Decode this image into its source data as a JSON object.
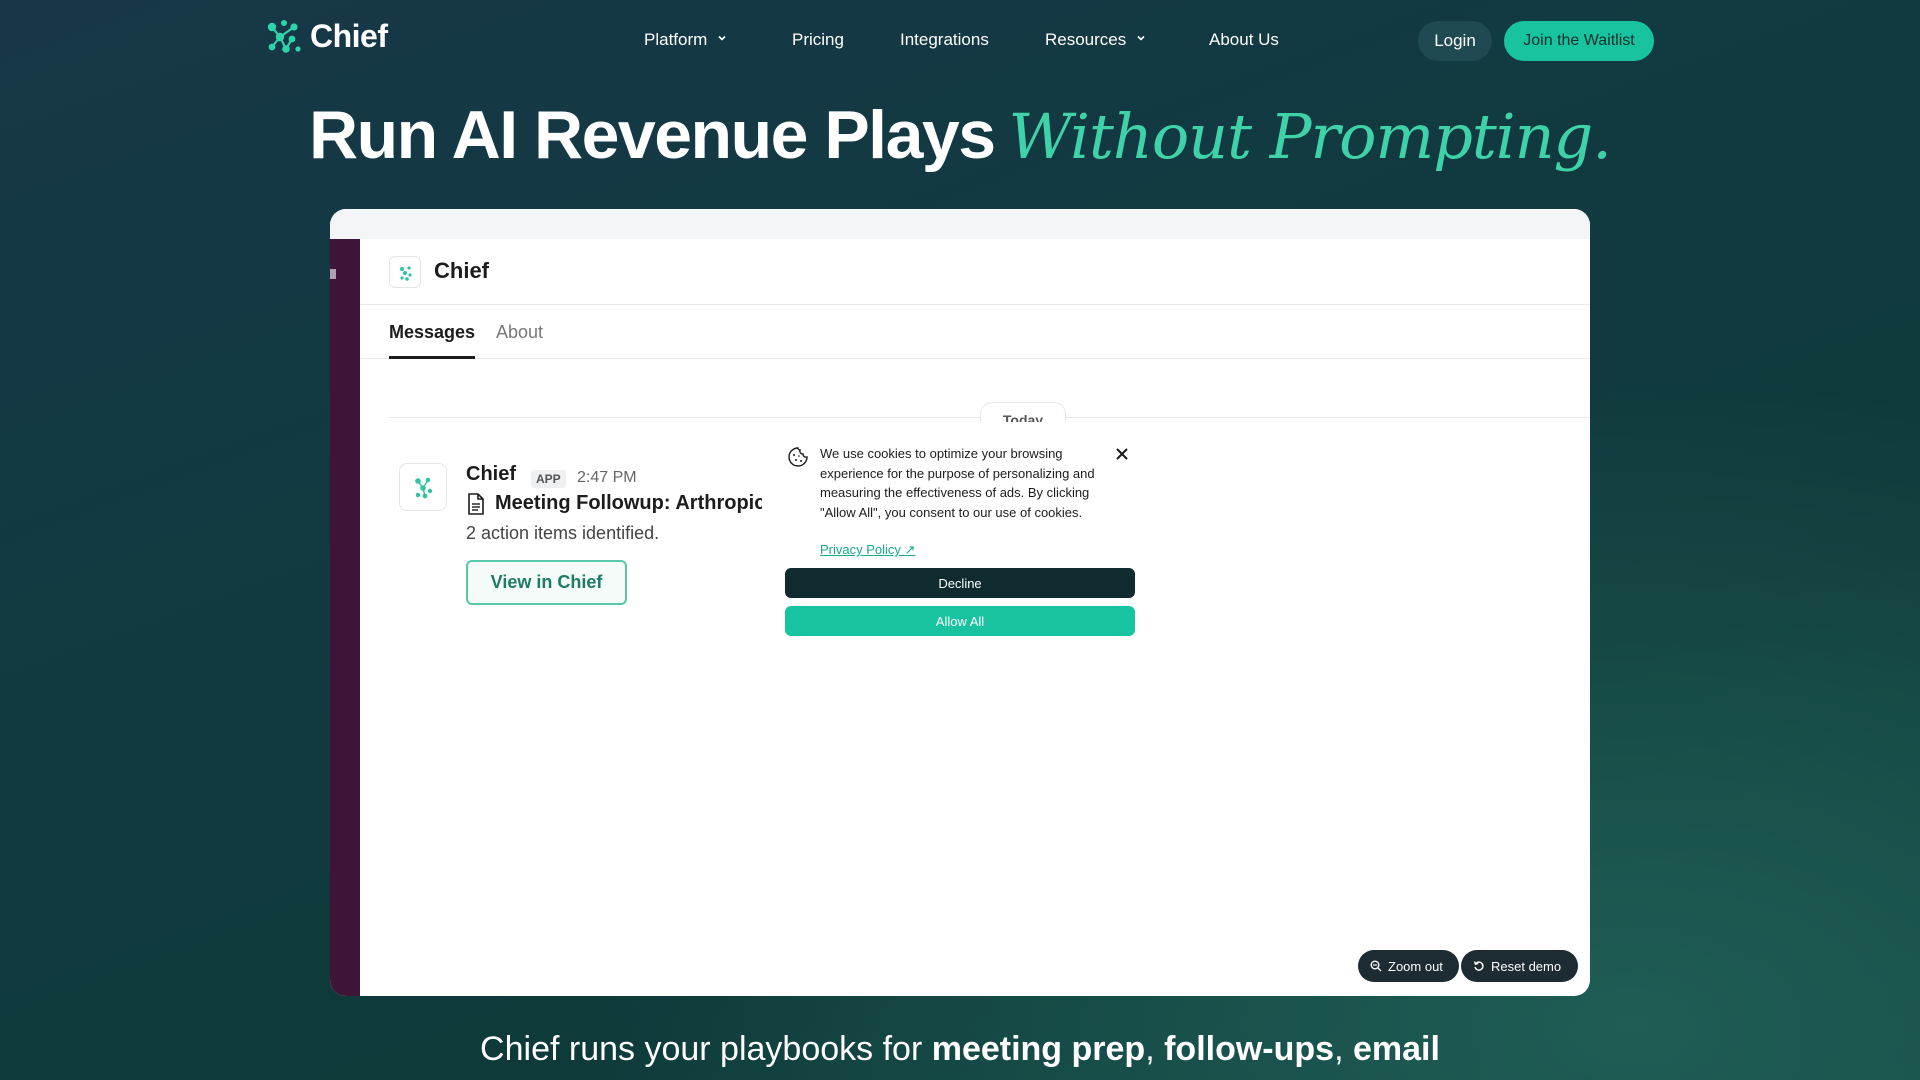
{
  "nav": {
    "logo_text": "Chief",
    "links": [
      {
        "label": "Platform",
        "has_chevron": true
      },
      {
        "label": "Pricing",
        "has_chevron": false
      },
      {
        "label": "Integrations",
        "has_chevron": false
      },
      {
        "label": "Resources",
        "has_chevron": true
      },
      {
        "label": "About Us",
        "has_chevron": false
      }
    ],
    "login_label": "Login",
    "waitlist_label": "Join the Waitlist"
  },
  "hero": {
    "main": "Run AI Revenue Plays",
    "accent": "Without Prompting."
  },
  "demo": {
    "channel_name": "Chief",
    "tabs": [
      "Messages",
      "About"
    ],
    "day_label": "Today",
    "message": {
      "sender": "Chief",
      "badge": "APP",
      "time": "2:47 PM",
      "title": "Meeting Followup: Arthropic",
      "body": "2 action items identified.",
      "button": "View in Chief"
    },
    "controls": {
      "zoom_out": "Zoom out",
      "reset": "Reset demo"
    }
  },
  "cookie": {
    "text": "We use cookies to optimize your browsing experience for the purpose of personalizing and measuring the effectiveness of ads. By clicking \"Allow All\", you consent to our use of cookies.",
    "link": "Privacy Policy ↗",
    "decline": "Decline",
    "allow": "Allow All"
  },
  "subhead": {
    "prefix": "Chief runs your playbooks for ",
    "b1": "meeting prep",
    "sep1": ", ",
    "b2": "follow-ups",
    "sep2": ", ",
    "b3": "email"
  },
  "colors": {
    "brand_accent": "#17c49f",
    "hero_accent": "#3fd2a9",
    "slack_sidebar": "#3e1438"
  }
}
